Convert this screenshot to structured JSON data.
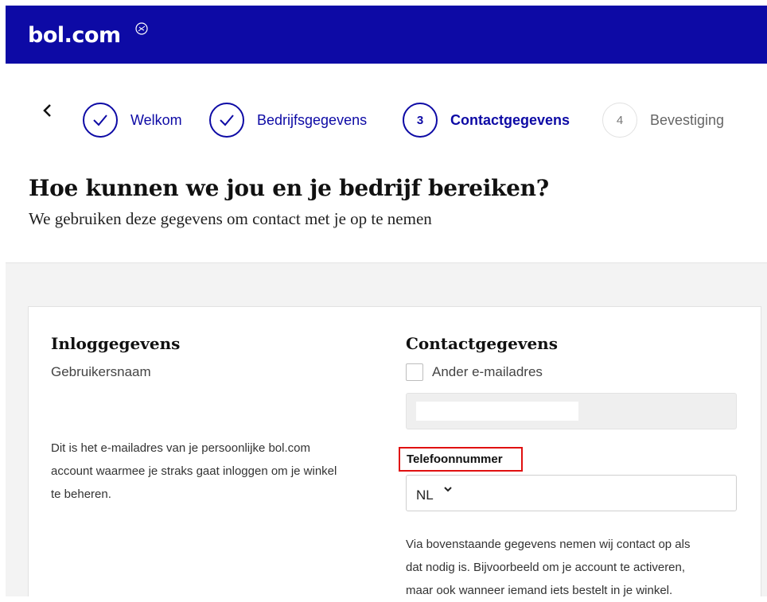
{
  "header": {
    "logo_text": "bol.com",
    "bg_color": "#0d0aa5"
  },
  "stepper": {
    "back_icon": "chevron-left-icon",
    "steps": [
      {
        "marker": "✓",
        "label": "Welkom",
        "state": "done"
      },
      {
        "marker": "✓",
        "label": "Bedrijfsgegevens",
        "state": "done"
      },
      {
        "marker": "3",
        "label": "Contactgegevens",
        "state": "active"
      },
      {
        "marker": "4",
        "label": "Bevestiging",
        "state": "todo"
      }
    ]
  },
  "page": {
    "title": "Hoe kunnen we jou en je bedrijf bereiken?",
    "subtitle": "We gebruiken deze gegevens om contact met je op te nemen"
  },
  "login": {
    "heading": "Inloggegevens",
    "username_label": "Gebruikersnaam",
    "description_lines": [
      "Dit is het e-mailadres van je persoonlijke bol.com",
      "account waarmee je straks gaat inloggen om je winkel",
      "te beheren."
    ]
  },
  "contact": {
    "heading": "Contactgegevens",
    "other_email_label": "Ander e-mailadres",
    "other_email_checked": false,
    "phone_label": "Telefoonnummer",
    "phone_country": "NL",
    "info_lines": [
      "Via bovenstaande gegevens nemen wij contact op als",
      "dat nodig is. Bijvoorbeeld om je account te activeren,",
      "maar ook wanneer iemand iets bestelt in je winkel."
    ]
  },
  "colors": {
    "brand": "#0d0aa5",
    "highlight": "#e01010"
  }
}
